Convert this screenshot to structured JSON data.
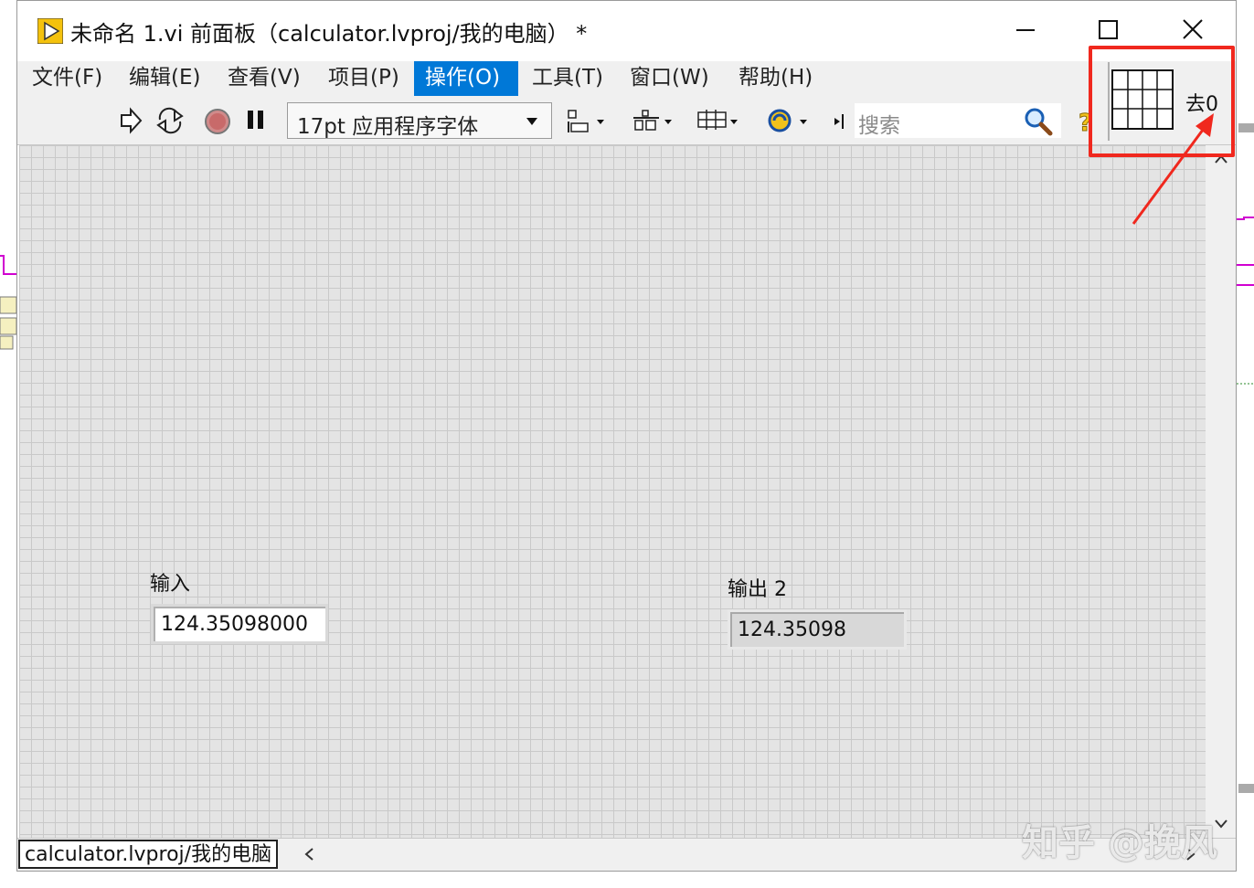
{
  "window": {
    "title": "未命名 1.vi 前面板（calculator.lvproj/我的电脑） *"
  },
  "menu": {
    "items": [
      "文件(F)",
      "编辑(E)",
      "查看(V)",
      "项目(P)",
      "操作(O)",
      "工具(T)",
      "窗口(W)",
      "帮助(H)"
    ],
    "active": "操作(O)"
  },
  "toolbar": {
    "font": "17pt 应用程序字体",
    "search_placeholder": "搜索"
  },
  "front_panel": {
    "input": {
      "label": "输入",
      "value": "124.35098000"
    },
    "output": {
      "label": "输出 2",
      "value": "124.35098"
    }
  },
  "connector_pane": {
    "label": "去0"
  },
  "status": {
    "context": "calculator.lvproj/我的电脑"
  },
  "watermark": "知乎 @挽风",
  "colors": {
    "highlight": "#f0281e",
    "menu_active": "#0078d7",
    "grid": "#e4e4e4"
  }
}
